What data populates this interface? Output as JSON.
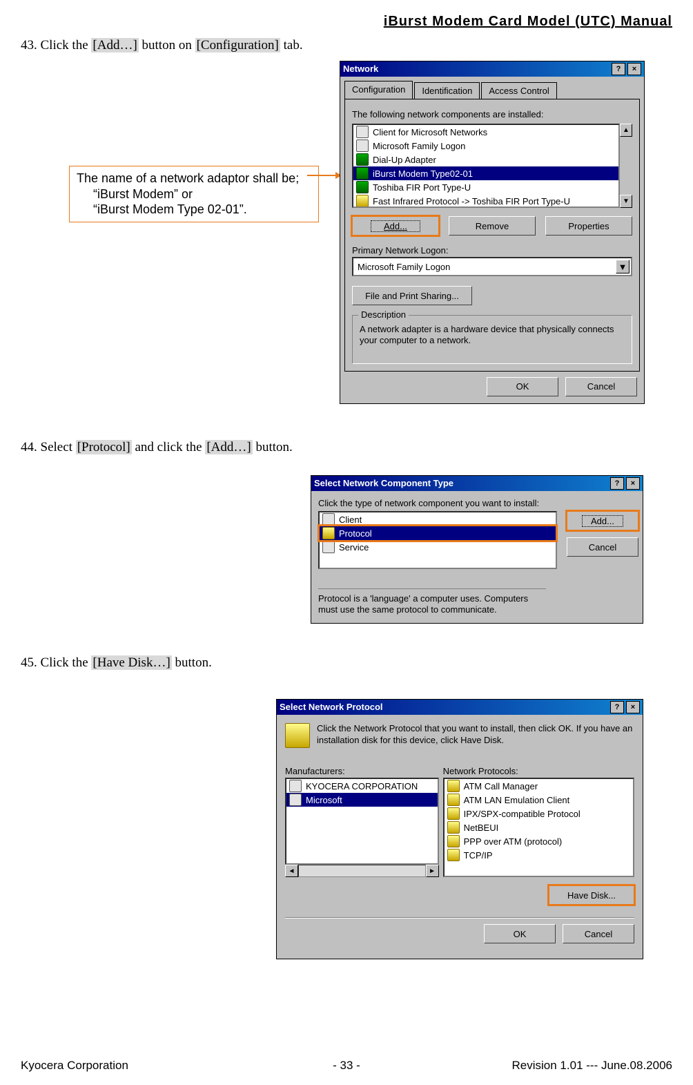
{
  "header": {
    "manual_title": "iBurst Modem Card Model (UTC) Manual"
  },
  "steps": {
    "s43_pre": "43. Click the ",
    "s43_b1": "[Add…]",
    "s43_mid": " button on ",
    "s43_b2": "[Configuration]",
    "s43_post": " tab.",
    "s44_pre": "44. Select ",
    "s44_b1": "[Protocol]",
    "s44_mid": " and click the ",
    "s44_b2": "[Add…]",
    "s44_post": " button.",
    "s45_pre": "45. Click the ",
    "s45_b1": "[Have Disk…]",
    "s45_post": " button."
  },
  "callout": {
    "line1": "The name of a network adaptor shall be;",
    "line2": "“iBurst Modem” or",
    "line3": "“iBurst Modem Type 02-01”."
  },
  "dlg_network": {
    "title": "Network",
    "tabs": {
      "configuration": "Configuration",
      "identification": "Identification",
      "access": "Access Control"
    },
    "components_label": "The following network components are installed:",
    "items": [
      "Client for Microsoft Networks",
      "Microsoft Family Logon",
      "Dial-Up Adapter",
      "iBurst Modem Type02-01",
      "Toshiba FIR Port Type-U",
      "Fast Infrared Protocol -> Toshiba FIR Port Type-U"
    ],
    "add": "Add...",
    "remove": "Remove",
    "properties": "Properties",
    "primary_net_logon_label": "Primary Network Logon:",
    "primary_net_logon_value": "Microsoft Family Logon",
    "file_print": "File and Print Sharing...",
    "desc_group": "Description",
    "desc_text": "A network adapter is a hardware device that physically connects your computer to a network.",
    "ok": "OK",
    "cancel": "Cancel"
  },
  "dlg_comptype": {
    "title": "Select Network Component Type",
    "prompt": "Click the type of network component you want to install:",
    "items": {
      "client": "Client",
      "protocol": "Protocol",
      "service": "Service"
    },
    "add": "Add...",
    "cancel": "Cancel",
    "desc": "Protocol is a 'language' a computer uses. Computers must use the same protocol to communicate."
  },
  "dlg_netproto": {
    "title": "Select Network Protocol",
    "prompt": "Click the Network Protocol that you want to install, then click OK. If you have an installation disk for this device, click Have Disk.",
    "mfr_label": "Manufacturers:",
    "proto_label": "Network Protocols:",
    "mfrs": [
      "KYOCERA CORPORATION",
      "Microsoft"
    ],
    "protos": [
      "ATM Call Manager",
      "ATM LAN Emulation Client",
      "IPX/SPX-compatible Protocol",
      "NetBEUI",
      "PPP over ATM (protocol)",
      "TCP/IP"
    ],
    "have_disk": "Have Disk...",
    "ok": "OK",
    "cancel": "Cancel"
  },
  "footer": {
    "left": "Kyocera Corporation",
    "center": "- 33 -",
    "right": "Revision 1.01 --- June.08.2006"
  }
}
